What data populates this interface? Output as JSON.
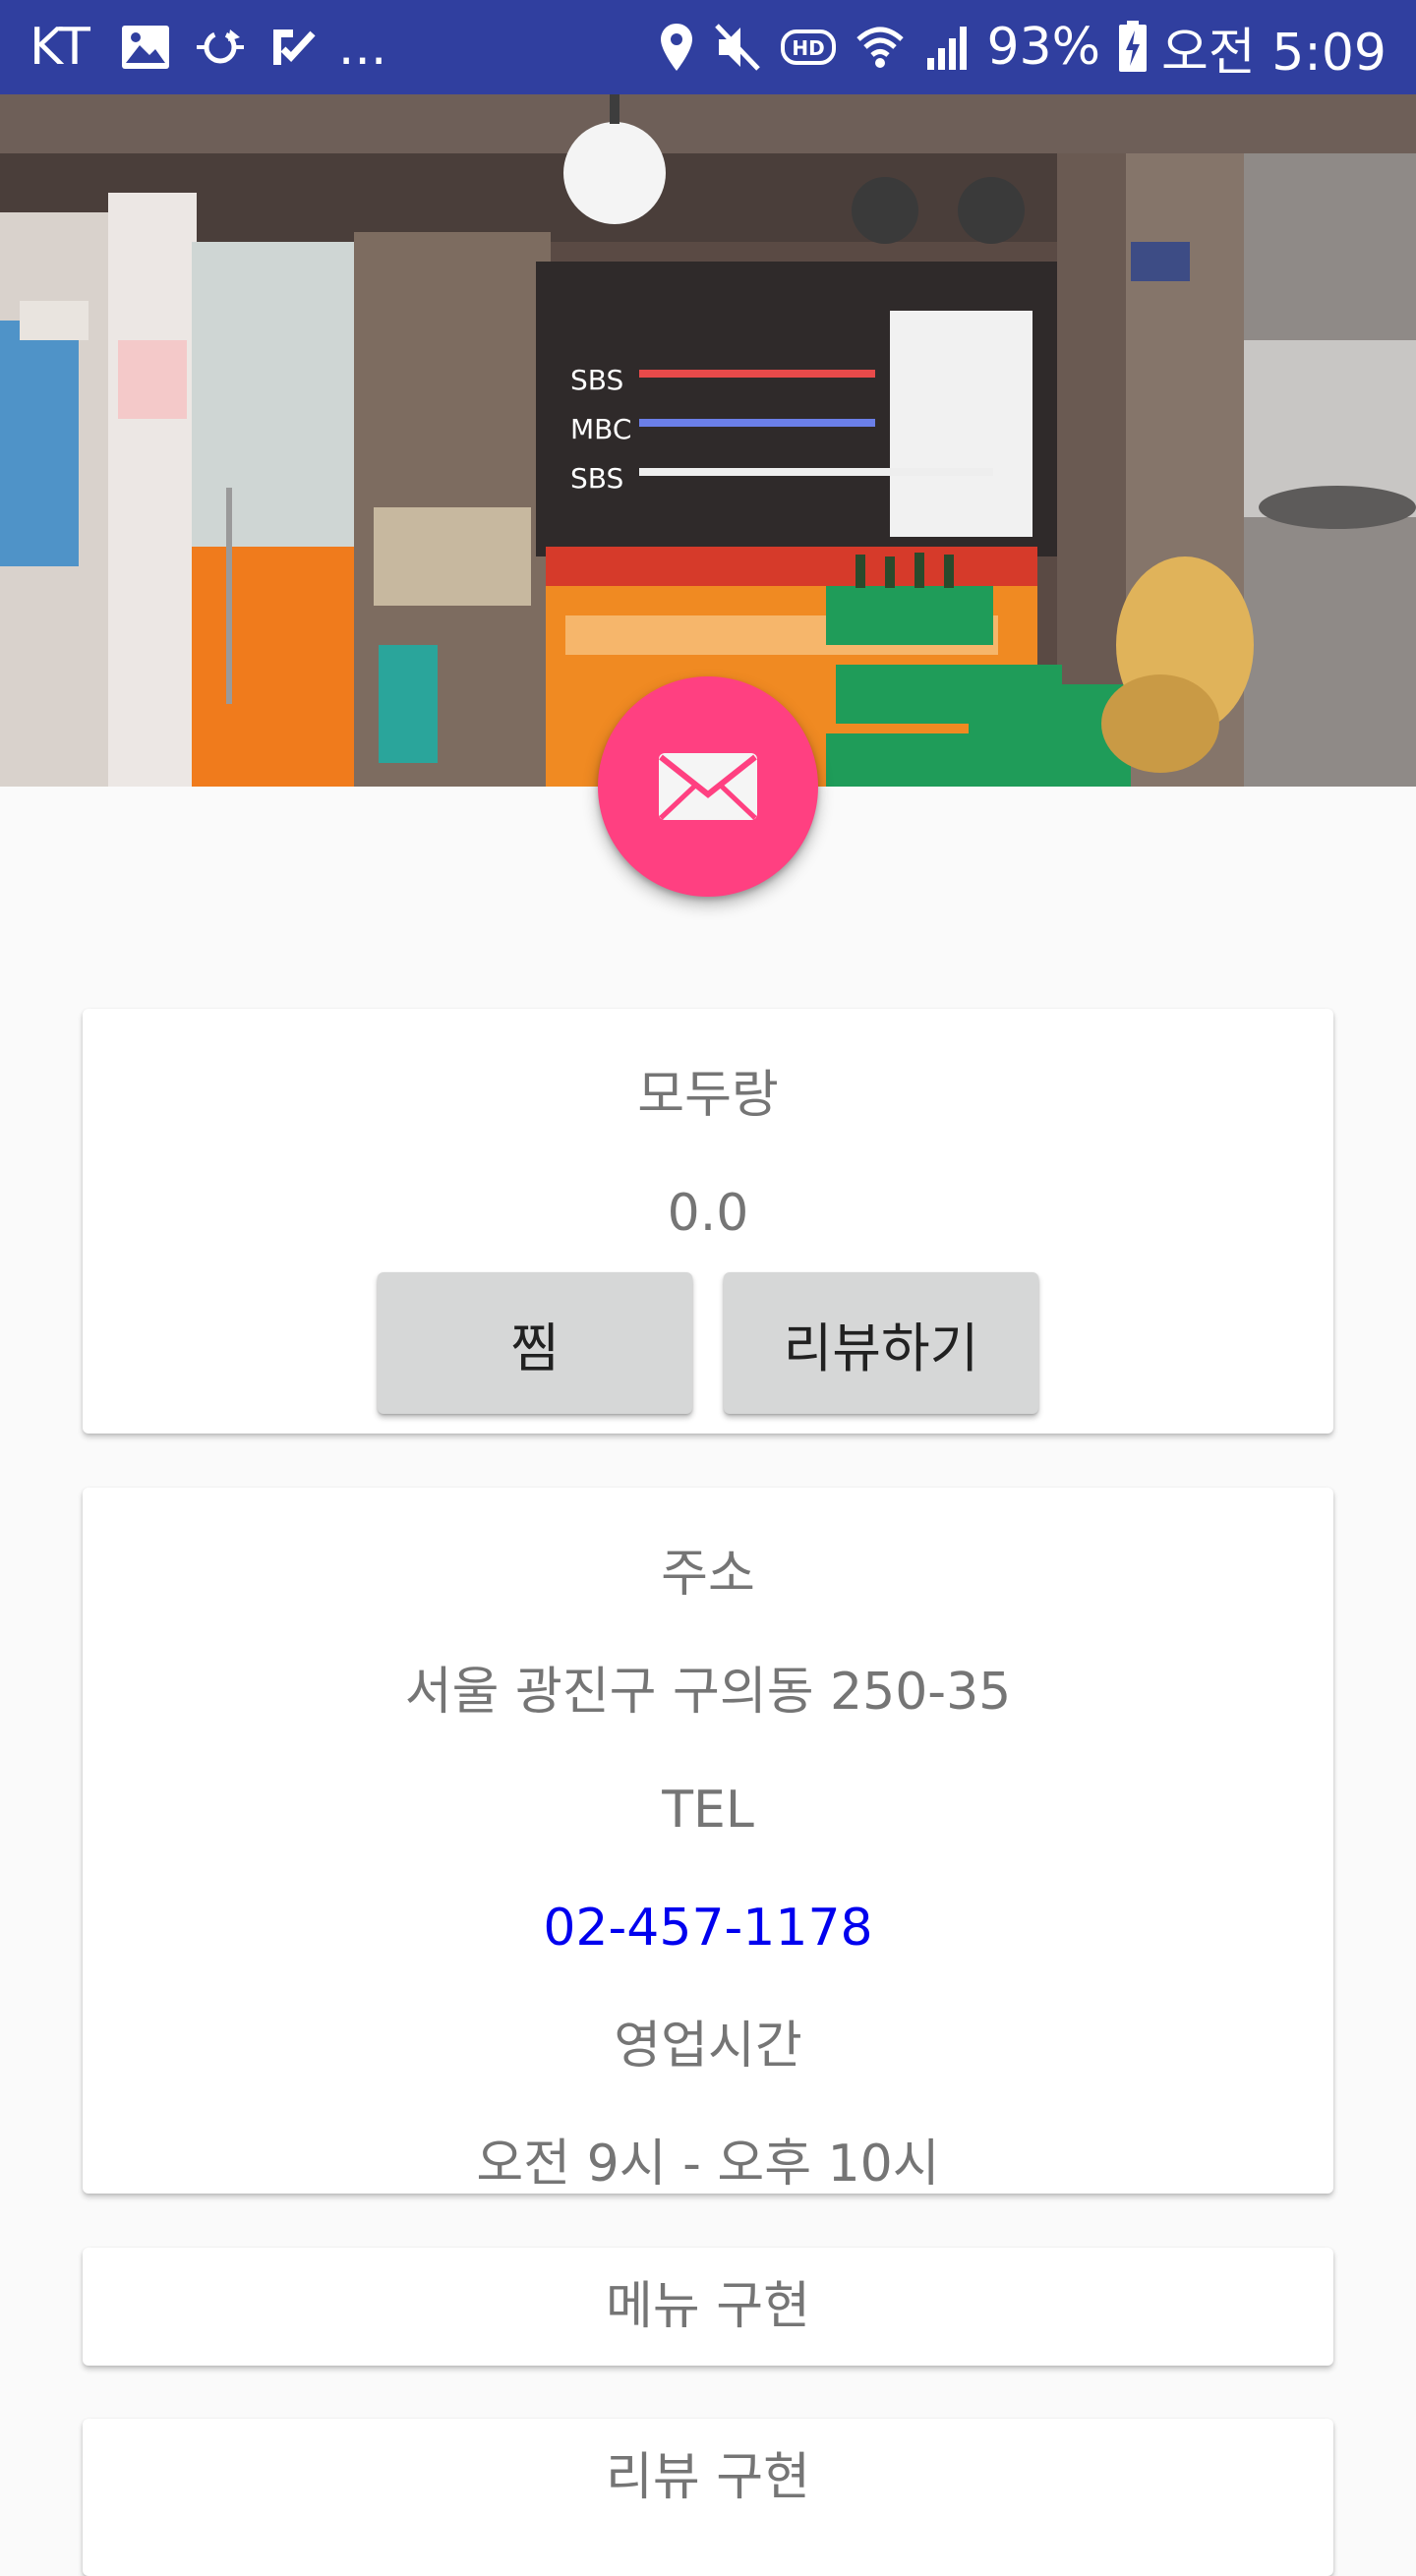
{
  "status_bar": {
    "carrier": "KT",
    "more": "...",
    "battery_percent": "93%",
    "time": "오전 5:09",
    "icons_left": [
      "image-icon",
      "sync-icon",
      "checkmark-notification-icon"
    ],
    "icons_right": [
      "location-icon",
      "mute-icon",
      "hd-icon",
      "wifi-icon",
      "signal-icon",
      "battery-charging-icon"
    ],
    "background_color": "#303f9f"
  },
  "hero": {
    "description_icon": "restaurant-storefront-photo"
  },
  "fab": {
    "icon": "mail-icon",
    "color": "#ff4081"
  },
  "restaurant": {
    "name": "모두랑",
    "rating": "0.0",
    "favorite_label": "찜",
    "review_label": "리뷰하기"
  },
  "info": {
    "address_label": "주소",
    "address": "서울 광진구 구의동 250-35",
    "tel_label": "TEL",
    "tel": "02-457-1178",
    "hours_label": "영업시간",
    "hours": "오전 9시 - 오후 10시"
  },
  "sections": {
    "menu": "메뉴 구현",
    "review": "리뷰 구현"
  },
  "colors": {
    "link": "#0000ee",
    "text_secondary": "#757575",
    "button_bg": "#d6d7d7"
  }
}
